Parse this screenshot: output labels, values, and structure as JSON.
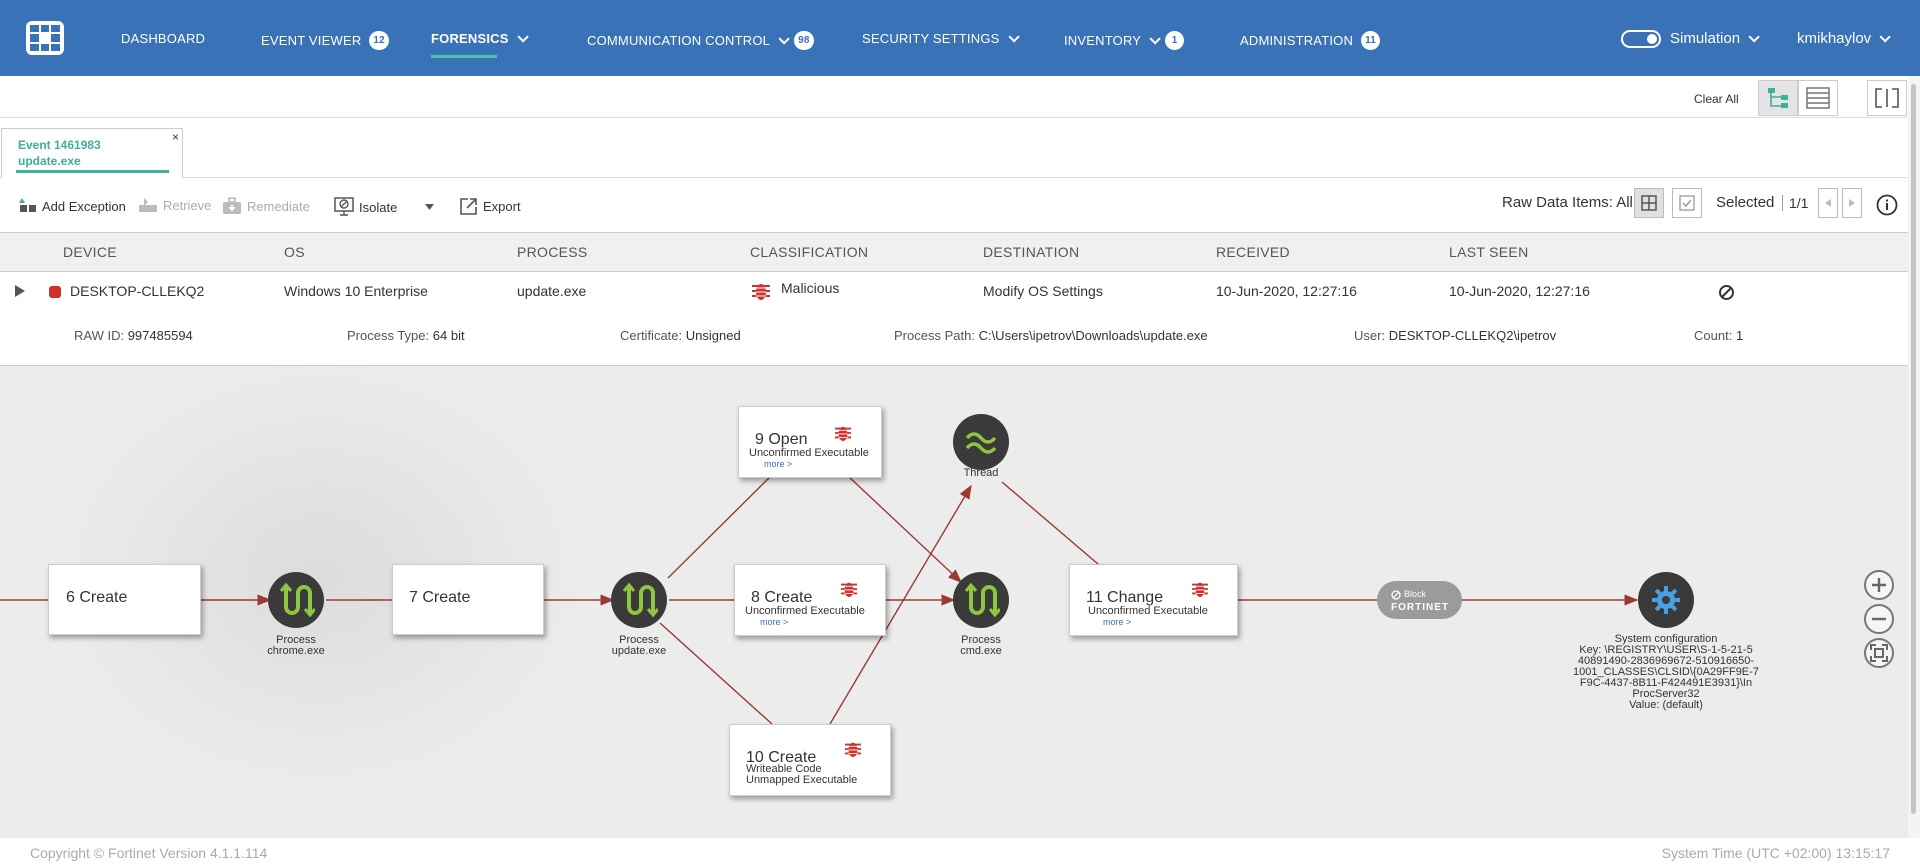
{
  "nav": {
    "items": [
      {
        "label": "DASHBOARD"
      },
      {
        "label": "EVENT VIEWER",
        "badge": "12"
      },
      {
        "label": "FORENSICS"
      },
      {
        "label": "COMMUNICATION CONTROL",
        "badge": "98"
      },
      {
        "label": "SECURITY SETTINGS"
      },
      {
        "label": "INVENTORY",
        "badge": "1"
      },
      {
        "label": "ADMINISTRATION",
        "badge": "11"
      }
    ],
    "simulation_label": "Simulation",
    "user": "kmikhaylov"
  },
  "subbar": {
    "clear_all": "Clear All"
  },
  "tab": {
    "event": "Event 1461983",
    "process": "update.exe",
    "close": "×"
  },
  "toolbar": {
    "add_exception": "Add Exception",
    "retrieve": "Retrieve",
    "remediate": "Remediate",
    "isolate": "Isolate",
    "export": "Export",
    "raw_data": "Raw Data Items: All",
    "selected": "Selected",
    "page": "1/1"
  },
  "table": {
    "headers": [
      "DEVICE",
      "OS",
      "PROCESS",
      "CLASSIFICATION",
      "DESTINATION",
      "RECEIVED",
      "LAST SEEN"
    ],
    "row": {
      "device": "DESKTOP-CLLEKQ2",
      "os": "Windows 10 Enterprise",
      "process": "update.exe",
      "classification": "Malicious",
      "destination": "Modify OS Settings",
      "received": "10-Jun-2020, 12:27:16",
      "last_seen": "10-Jun-2020, 12:27:16"
    },
    "details": {
      "raw_id_label": "RAW ID:",
      "raw_id": "997485594",
      "process_type_label": "Process Type:",
      "process_type": "64 bit",
      "certificate_label": "Certificate:",
      "certificate": "Unsigned",
      "process_path_label": "Process Path:",
      "process_path": "C:\\Users\\ipetrov\\Downloads\\update.exe",
      "user_label": "User:",
      "user": "DESKTOP-CLLEKQ2\\ipetrov",
      "count_label": "Count:",
      "count": "1"
    }
  },
  "graph": {
    "boxes": {
      "n6": {
        "title": "6 Create"
      },
      "n7": {
        "title": "7 Create"
      },
      "n9": {
        "title": "9 Open",
        "sub": "Unconfirmed Executable",
        "more": "more >"
      },
      "n8": {
        "title": "8 Create",
        "sub": "Unconfirmed Executable",
        "more": "more >"
      },
      "n10": {
        "title": "10 Create",
        "sub1": "Writeable Code",
        "sub2": "Unmapped Executable"
      },
      "n11": {
        "title": "11 Change",
        "sub": "Unconfirmed Executable",
        "more": "more >"
      }
    },
    "circles": {
      "chrome": {
        "l1": "Process",
        "l2": "chrome.exe"
      },
      "update": {
        "l1": "Process",
        "l2": "update.exe"
      },
      "cmd": {
        "l1": "Process",
        "l2": "cmd.exe"
      },
      "thread": {
        "l1": "Thread"
      },
      "sysconf": {
        "l1": "System configuration",
        "l2": "Key: \\REGISTRY\\USER\\S-1-5-21-5",
        "l3": "40891490-2836969672-510916650-",
        "l4": "1001_CLASSES\\CLSID\\{0A29FF9E-7",
        "l5": "F9C-4437-8B11-F424491E3931}\\In",
        "l6": "ProcServer32",
        "l7": "Value: (default)"
      }
    },
    "block": {
      "label": "Block",
      "brand": "FORTINET"
    }
  },
  "footer": {
    "copyright": "Copyright © Fortinet Version 4.1.1.114",
    "system_time": "System Time (UTC +02:00) 13:15:17"
  },
  "colors": {
    "nav": "#3a72b8",
    "accent": "#3fae9a",
    "edge": "#9a3a32",
    "malicious": "#d0312d"
  }
}
